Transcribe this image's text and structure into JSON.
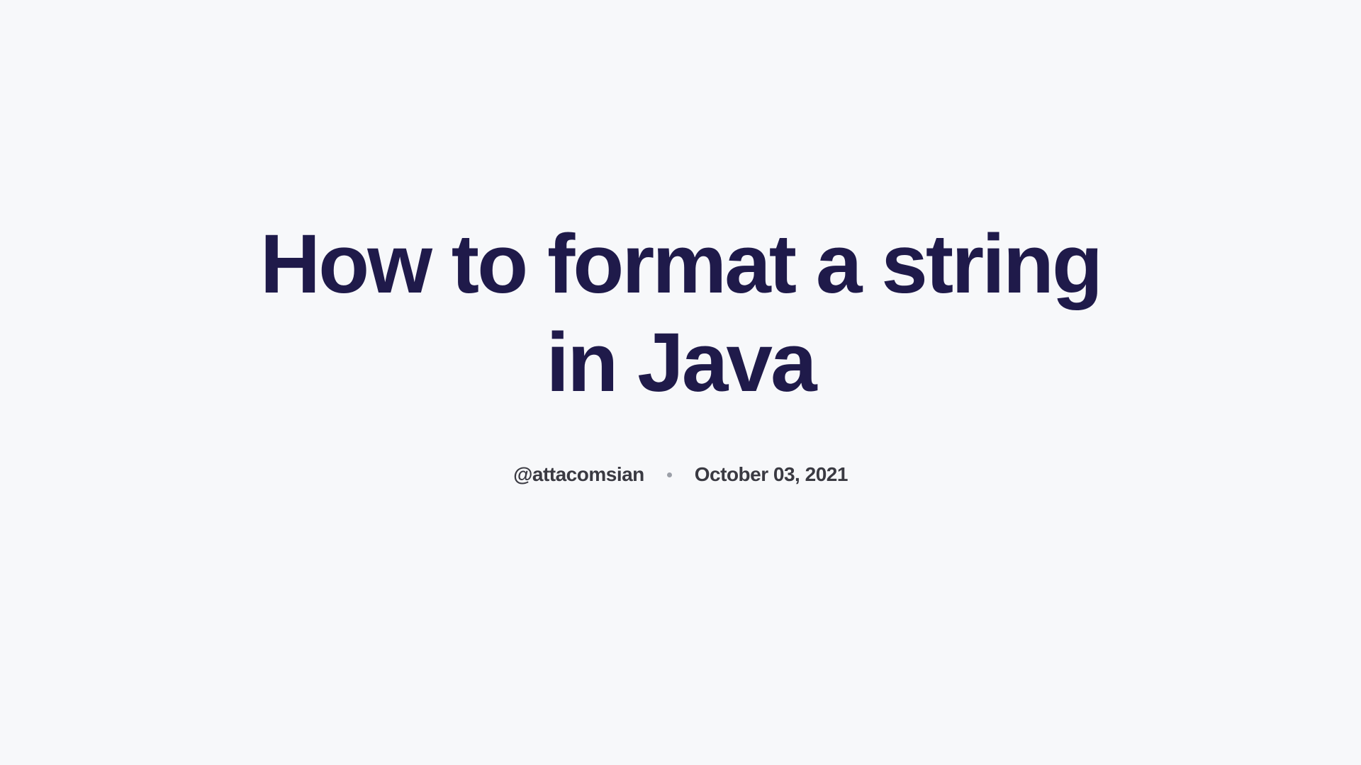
{
  "article": {
    "title": "How to format a string in Java",
    "author": "@attacomsian",
    "date": "October 03, 2021"
  }
}
